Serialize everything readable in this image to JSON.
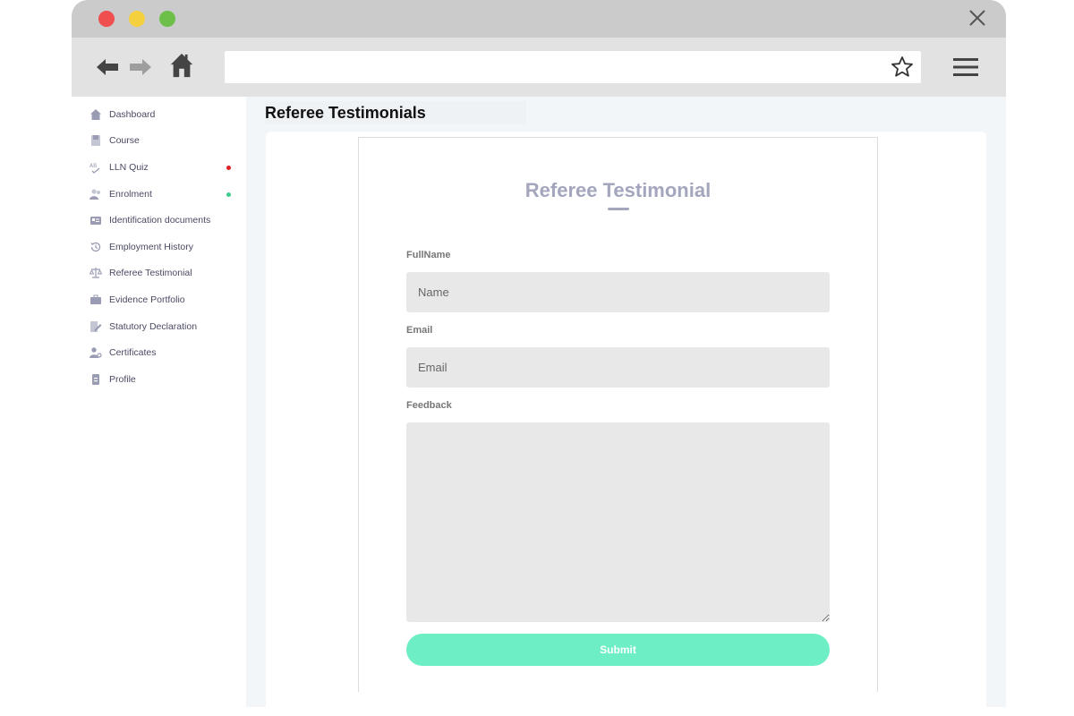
{
  "browser": {
    "icons": [
      "close-icon",
      "back-arrow-icon",
      "forward-arrow-icon",
      "home-icon",
      "star-icon",
      "hamburger-menu-icon"
    ],
    "traffic_lights": {
      "red": "#ef4f4f",
      "yellow": "#f4d03f",
      "green": "#6cc04a"
    }
  },
  "sidebar": {
    "items": [
      {
        "label": "Dashboard",
        "icon": "home-icon"
      },
      {
        "label": "Course",
        "icon": "book-icon"
      },
      {
        "label": "LLN Quiz",
        "icon": "abc-icon",
        "status_dot": "#e02020"
      },
      {
        "label": "Enrolment",
        "icon": "users-icon",
        "status_dot": "#3ecf8e"
      },
      {
        "label": "Identification documents",
        "icon": "id-card-icon"
      },
      {
        "label": "Employment History",
        "icon": "history-icon"
      },
      {
        "label": "Referee Testimonial",
        "icon": "scale-icon"
      },
      {
        "label": "Evidence Portfolio",
        "icon": "briefcase-icon"
      },
      {
        "label": "Statutory Declaration",
        "icon": "document-sign-icon"
      },
      {
        "label": "Certificates",
        "icon": "user-certificate-icon"
      },
      {
        "label": "Profile",
        "icon": "profile-icon"
      }
    ]
  },
  "main": {
    "page_title": "Referee Testimonials",
    "form": {
      "heading": "Referee Testimonial",
      "fullname_label": "FullName",
      "fullname_placeholder": "Name",
      "email_label": "Email",
      "email_placeholder": "Email",
      "feedback_label": "Feedback",
      "submit_label": "Submit"
    }
  },
  "colors": {
    "accent": "#6deec4",
    "heading": "#a3a6bd"
  }
}
